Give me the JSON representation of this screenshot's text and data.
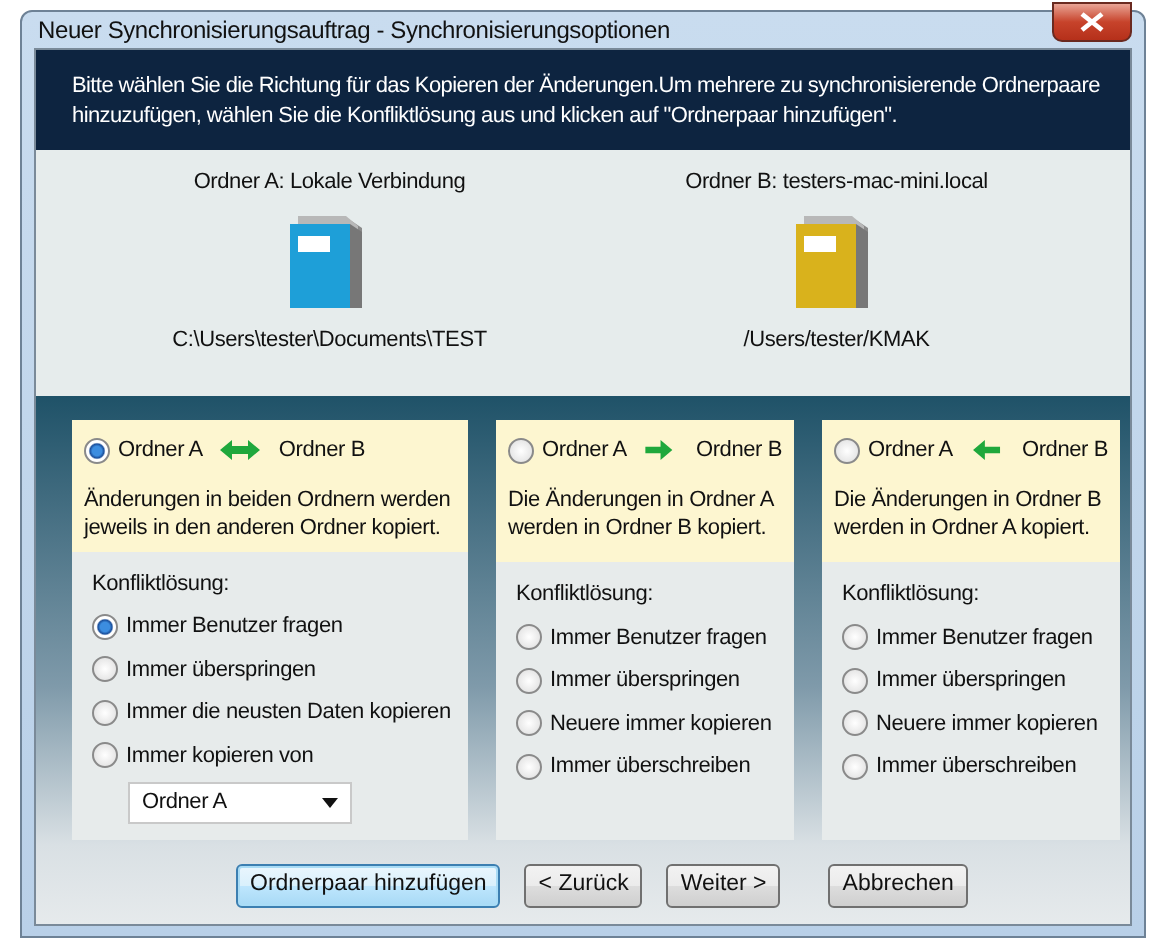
{
  "window": {
    "title": "Neuer Synchronisierungsauftrag - Synchronisierungsoptionen"
  },
  "instructions": "Bitte wählen Sie die Richtung für das Kopieren der Änderungen.Um mehrere zu synchronisierende Ordnerpaare hinzuzufügen, wählen Sie die Konfliktlösung aus und klicken auf \"Ordnerpaar hinzufügen\".",
  "folders": [
    {
      "label": "Ordner A: Lokale Verbindung",
      "path": "C:\\Users\\tester\\Documents\\TEST",
      "color": "#1e9fd8"
    },
    {
      "label": "Ordner B: testers-mac-mini.local",
      "path": "/Users/tester/KMAK",
      "color": "#d9b21c"
    }
  ],
  "directions": [
    {
      "selected": true,
      "kind": "both",
      "from": "Ordner A",
      "to": "Ordner B",
      "description": "Änderungen in beiden Ordnern werden jeweils in den anderen Ordner kopiert.",
      "conflict_label": "Konfliktlösung:",
      "options": [
        {
          "label": "Immer Benutzer fragen",
          "selected": true
        },
        {
          "label": "Immer überspringen",
          "selected": false
        },
        {
          "label": "Immer die neusten Daten kopieren",
          "selected": false
        },
        {
          "label": "Immer kopieren von",
          "selected": false
        }
      ],
      "dropdown": {
        "value": "Ordner A"
      }
    },
    {
      "selected": false,
      "kind": "right",
      "from": "Ordner A",
      "to": "Ordner B",
      "description": "Die Änderungen in Ordner A werden in Ordner B kopiert.",
      "conflict_label": "Konfliktlösung:",
      "options": [
        {
          "label": "Immer Benutzer fragen",
          "selected": false
        },
        {
          "label": "Immer überspringen",
          "selected": false
        },
        {
          "label": "Neuere immer kopieren",
          "selected": false
        },
        {
          "label": "Immer überschreiben",
          "selected": false
        }
      ]
    },
    {
      "selected": false,
      "kind": "left",
      "from": "Ordner A",
      "to": "Ordner B",
      "description": "Die Änderungen in Ordner B werden in Ordner A kopiert.",
      "conflict_label": "Konfliktlösung:",
      "options": [
        {
          "label": "Immer Benutzer fragen",
          "selected": false
        },
        {
          "label": "Immer überspringen",
          "selected": false
        },
        {
          "label": "Neuere immer kopieren",
          "selected": false
        },
        {
          "label": "Immer überschreiben",
          "selected": false
        }
      ]
    }
  ],
  "buttons": [
    {
      "label": "Ordnerpaar hinzufügen",
      "default": true
    },
    {
      "label": "< Zurück",
      "default": false
    },
    {
      "label": "Weiter >",
      "default": false
    },
    {
      "label": "Abbrechen",
      "default": false
    }
  ]
}
